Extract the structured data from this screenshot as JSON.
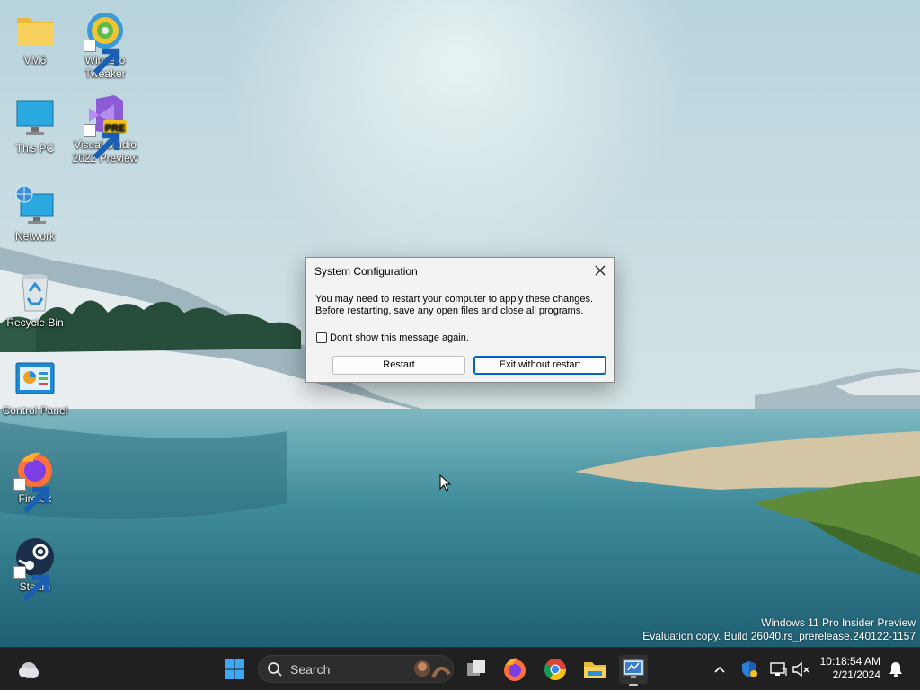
{
  "desktop": {
    "icons": [
      {
        "label": "VM6"
      },
      {
        "label": "Winaero\nTweaker"
      },
      {
        "label": "This PC"
      },
      {
        "label": "Visual Studio\n2022 Preview",
        "badge": "PRE"
      },
      {
        "label": "Network"
      },
      {
        "label": "Recycle Bin"
      },
      {
        "label": "Control Panel"
      },
      {
        "label": "Firefox"
      },
      {
        "label": "Steam"
      }
    ],
    "watermark": {
      "line1": "Windows 11 Pro Insider Preview",
      "line2": "Evaluation copy. Build 26040.rs_prerelease.240122-1157"
    }
  },
  "dialog": {
    "title": "System Configuration",
    "message_line1": "You may need to restart your computer to apply these changes.",
    "message_line2": "Before restarting, save any open files and close all programs.",
    "checkbox_label": "Don't show this message again.",
    "checkbox_checked": false,
    "restart_label": "Restart",
    "exit_label": "Exit without restart"
  },
  "taskbar": {
    "search_label": "Search",
    "pinned": [
      "start-icon",
      "search-icon",
      "task-view-icon",
      "firefox-icon",
      "chrome-icon",
      "file-explorer-icon",
      "system-configuration-icon"
    ],
    "tray": [
      "chevron-up-icon",
      "defender-icon",
      "network-icon",
      "volume-muted-icon",
      "notification-bell-icon"
    ],
    "clock": {
      "time": "10:18:54 AM",
      "date": "2/21/2024"
    }
  },
  "colors": {
    "accent": "#0067c0",
    "taskbar": "#202020",
    "dialog_bg": "#f3f3f3"
  }
}
